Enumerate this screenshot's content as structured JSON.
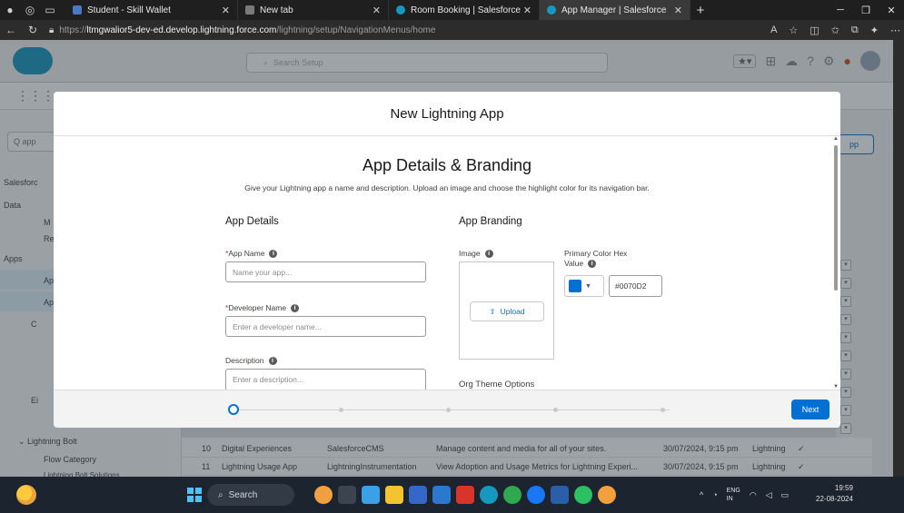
{
  "browser": {
    "tabs": [
      {
        "label": "Student - Skill Wallet",
        "color": "#4a78c2"
      },
      {
        "label": "New tab",
        "color": "#7a7a7a"
      },
      {
        "label": "Room Booking | Salesforce",
        "color": "#1798c1"
      },
      {
        "label": "App Manager | Salesforce",
        "color": "#1798c1"
      }
    ],
    "url_prefix": "https://",
    "url_host": "ltmgwalior5-dev-ed.develop.lightning.force.com",
    "url_path": "/lightning/setup/NavigationMenus/home"
  },
  "sf_header": {
    "search_placeholder": "Search Setup"
  },
  "sidebar": {
    "quick_find": "Q  app",
    "items": [
      "Salesforc",
      "Data",
      "M",
      "Re",
      "Apps",
      "Ap",
      "Ap",
      "C",
      "Ei",
      "Lightning Bolt",
      "Flow Category",
      "Lightning Bolt Solutions"
    ]
  },
  "bg_table": {
    "rows": [
      {
        "num": "10",
        "name": "Digital Experiences",
        "dev": "SalesforceCMS",
        "desc": "Manage content and media for all of your sites.",
        "date": "30/07/2024, 9:15 pm",
        "type": "Lightning",
        "check": "✓"
      },
      {
        "num": "11",
        "name": "Lightning Usage App",
        "dev": "LightningInstrumentation",
        "desc": "View Adoption and Usage Metrics for Lightning Experi...",
        "date": "30/07/2024, 9:15 pm",
        "type": "Lightning",
        "check": "✓"
      }
    ],
    "right_button": "pp"
  },
  "modal": {
    "header": "New Lightning App",
    "title": "App Details & Branding",
    "description": "Give your Lightning app a name and description. Upload an image and choose the highlight color for its navigation bar.",
    "app_details": {
      "heading": "App Details",
      "app_name_label": "App Name",
      "app_name_placeholder": "Name your app...",
      "dev_name_label": "Developer Name",
      "dev_name_placeholder": "Enter a developer name...",
      "description_label": "Description",
      "description_placeholder": "Enter a description..."
    },
    "app_branding": {
      "heading": "App Branding",
      "image_label": "Image",
      "upload_label": "Upload",
      "primary_color_label_1": "Primary Color Hex",
      "primary_color_label_2": "Value",
      "color_value": "#0070D2",
      "swatch_color": "#0070d2",
      "org_theme_label": "Org Theme Options"
    },
    "footer": {
      "next_label": "Next",
      "current_step": 1,
      "total_steps": 5
    }
  },
  "taskbar": {
    "search_label": "Search",
    "tray_lang": "ENG",
    "tray_region": "IN",
    "time": "19:59",
    "date": "22-08-2024"
  }
}
